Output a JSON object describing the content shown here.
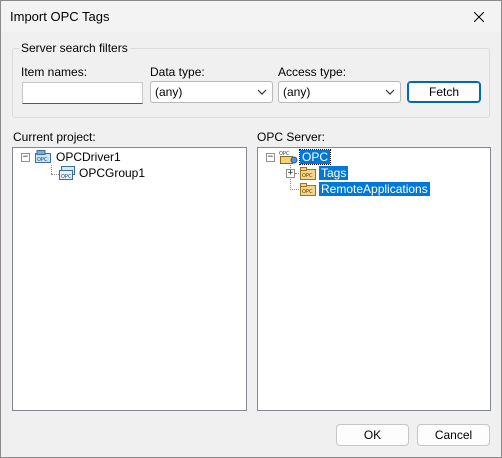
{
  "window": {
    "title": "Import OPC Tags"
  },
  "filters": {
    "legend": "Server search filters",
    "item_names_label": "Item names:",
    "item_names_value": "",
    "data_type_label": "Data type:",
    "data_type_value": "(any)",
    "access_type_label": "Access type:",
    "access_type_value": "(any)",
    "fetch_label": "Fetch"
  },
  "current_project": {
    "label": "Current project:",
    "tree": [
      {
        "label": "OPCDriver1",
        "icon": "opc-driver-icon",
        "expander": "−"
      },
      {
        "label": "OPCGroup1",
        "icon": "opc-group-icon"
      }
    ]
  },
  "opc_server": {
    "label": "OPC Server:",
    "tree": [
      {
        "label": "OPC",
        "icon": "opc-server-icon",
        "expander": "−",
        "selected": true
      },
      {
        "label": "Tags",
        "icon": "opc-folder-icon",
        "expander": "+",
        "selected": true
      },
      {
        "label": "RemoteApplications",
        "icon": "opc-folder-icon",
        "selected": true
      }
    ]
  },
  "footer": {
    "ok_label": "OK",
    "cancel_label": "Cancel"
  },
  "colors": {
    "selection": "#0078d7",
    "accent_border": "#0067c0"
  }
}
